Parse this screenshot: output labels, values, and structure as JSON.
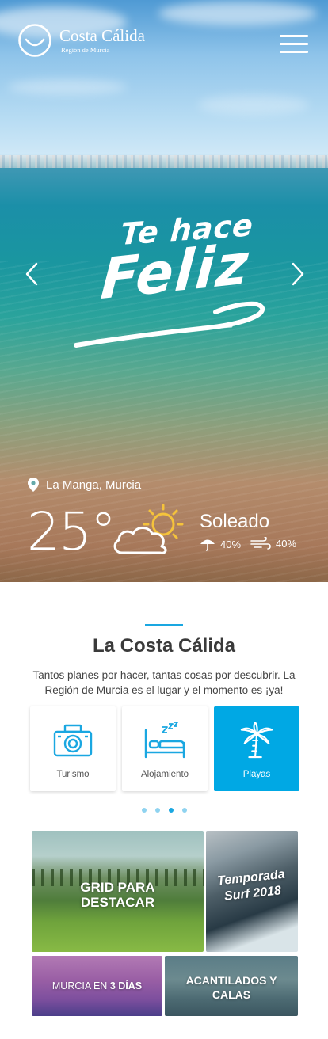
{
  "header": {
    "brand_name": "Costa Cálida",
    "brand_sub": "Región de Murcia",
    "menu_icon": "hamburger-menu-icon"
  },
  "hero": {
    "slogan_line1": "Te hace",
    "slogan_line2": "Feliz",
    "location": "La Manga, Murcia",
    "temperature": "25°",
    "condition": "Soleado",
    "rain_chance": "40%",
    "wind": "40%",
    "prev_icon": "chevron-left-icon",
    "next_icon": "chevron-right-icon"
  },
  "section": {
    "title": "La Costa Cálida",
    "description": "Tantos planes por hacer, tantas cosas por descubrir. La Región de Murcia  es el lugar y el momento es ¡ya!",
    "accent_color": "#1aa7e1"
  },
  "categories": [
    {
      "label": "Turismo",
      "icon": "camera-icon",
      "active": false
    },
    {
      "label": "Alojamiento",
      "icon": "bed-icon",
      "active": false
    },
    {
      "label": "Playas",
      "icon": "palm-tree-icon",
      "active": true
    }
  ],
  "carousel": {
    "pages": 4,
    "active_page": 3
  },
  "grid": {
    "tile1": {
      "line1": "GRID PARA",
      "line2": "DESTACAR"
    },
    "tile2": {
      "line1": "Temporada",
      "line2": "Surf 2018"
    },
    "tile3": {
      "prefix": "MURCIA EN ",
      "bold": "3 DÍAS"
    },
    "tile4": {
      "line1": "ACANTILADOS Y",
      "line2": "CALAS"
    }
  }
}
